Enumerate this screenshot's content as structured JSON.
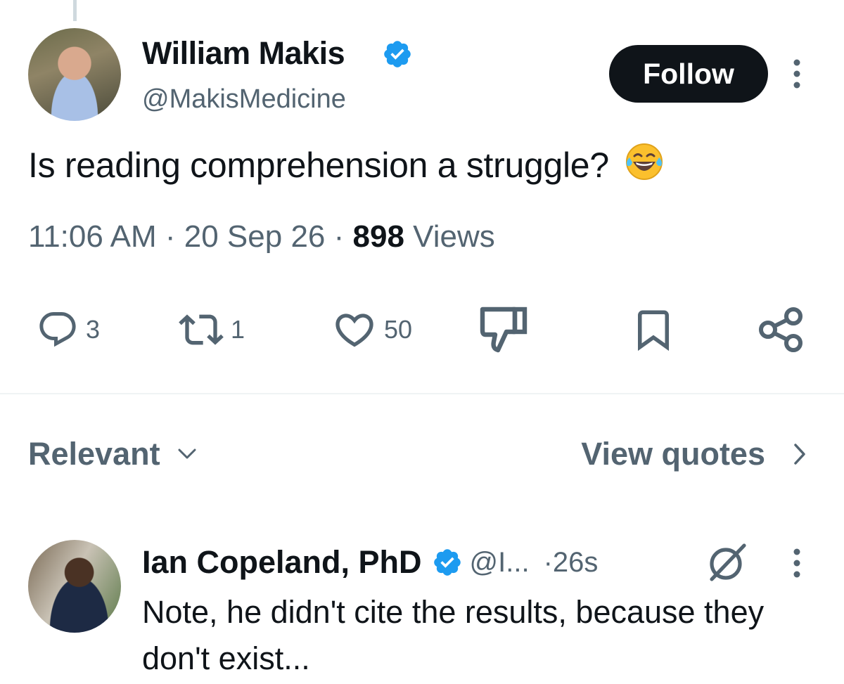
{
  "tweet": {
    "author_name": "William Makis",
    "author_handle": "@MakisMedicine",
    "follow_label": "Follow",
    "text": "Is reading comprehension a struggle?",
    "emoji": "face-with-tears-of-joy",
    "time": "11:06 AM",
    "date": "20 Sep 26",
    "views_count": "898",
    "views_label": "Views",
    "actions": {
      "replies": "3",
      "reposts": "1",
      "likes": "50"
    }
  },
  "filters": {
    "sort_label": "Relevant",
    "quotes_label": "View quotes"
  },
  "reply": {
    "author_name": "Ian Copeland, PhD",
    "author_handle": "@I...",
    "time": "26s",
    "text": "Note, he didn't cite the results, because they don't exist..."
  },
  "colors": {
    "verified": "#1d9bf0",
    "muted_text": "#536471",
    "follow_bg": "#0f1419"
  }
}
